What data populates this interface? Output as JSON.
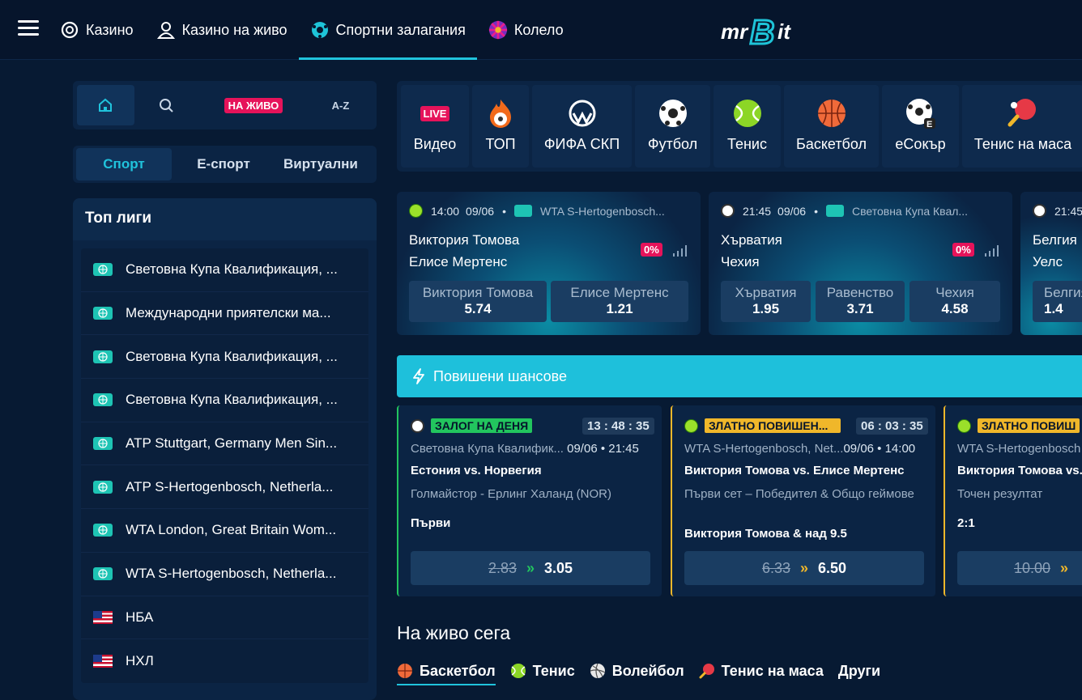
{
  "nav": {
    "items": [
      {
        "label": "Казино",
        "icon": "casino-chip-icon"
      },
      {
        "label": "Казино на живо",
        "icon": "live-dealer-icon"
      },
      {
        "label": "Спортни залагания",
        "icon": "soccer-ball-icon"
      },
      {
        "label": "Колело",
        "icon": "wheel-icon"
      }
    ],
    "logo_text": "mrBit"
  },
  "quick": {
    "live_label": "НА ЖИВО",
    "az_label": "A-Z"
  },
  "sport_tabs": [
    "Спорт",
    "Е-спорт",
    "Виртуални"
  ],
  "leagues": {
    "title": "Топ лиги",
    "items": [
      "Световна Купа Квалификация, ...",
      "Международни приятелски ма...",
      "Световна Купа Квалификация, ...",
      "Световна Купа Квалификация, ...",
      "ATP Stuttgart, Germany Men Sin...",
      "ATP S-Hertogenbosch, Netherla...",
      "WTA London, Great Britain Wom...",
      "WTA S-Hertogenbosch, Netherla...",
      "НБА",
      "НХЛ"
    ]
  },
  "sports": [
    {
      "label": "Видео",
      "live_badge": "LIVE"
    },
    {
      "label": "ТОП"
    },
    {
      "label": "ФИФА СКП"
    },
    {
      "label": "Футбол"
    },
    {
      "label": "Тенис"
    },
    {
      "label": "Баскетбол"
    },
    {
      "label": "еСокър",
      "badge": "E"
    },
    {
      "label": "Тенис на маса"
    }
  ],
  "matches": [
    {
      "time": "14:00",
      "date": "09/06",
      "league": "WTA S-Hertogenbosch...",
      "team1": "Виктория Томова",
      "team2": "Елисе Мертенс",
      "margin": "0%",
      "odds": [
        {
          "name": "Виктория Томова",
          "value": "5.74"
        },
        {
          "name": "Елисе Мертенс",
          "value": "1.21"
        }
      ]
    },
    {
      "time": "21:45",
      "date": "09/06",
      "league": "Световна Купа Квал...",
      "team1": "Хърватия",
      "team2": "Чехия",
      "margin": "0%",
      "odds": [
        {
          "name": "Хърватия",
          "value": "1.95"
        },
        {
          "name": "Равенство",
          "value": "3.71"
        },
        {
          "name": "Чехия",
          "value": "4.58"
        }
      ]
    },
    {
      "time": "21:45",
      "team1": "Белгия",
      "team2": "Уелс",
      "odds": [
        {
          "name": "Белгия",
          "value": "1.4"
        }
      ]
    }
  ],
  "boost": {
    "title": "Повишени шансове"
  },
  "boost_cards": [
    {
      "tag": "ЗАЛОГ НА ДЕНЯ",
      "tag_color": "#22c55e",
      "timer": "13 : 48 : 35",
      "league": "Световна Купа Квалифик...",
      "datetime": "09/06 • 21:45",
      "match": "Естония vs. Норвегия",
      "market": "Голмайстор - Ерлинг Халанд (NOR)",
      "selection": "Първи",
      "old": "2.83",
      "new": "3.05"
    },
    {
      "tag": "ЗЛАТНО ПОВИШЕН...",
      "tag_color": "#f0b72a",
      "timer": "06 : 03 : 35",
      "league": "WTA S-Hertogenbosch, Net...",
      "datetime": "09/06 • 14:00",
      "match": "Виктория Томова vs. Елисе Мертенс",
      "market": "Първи сет – Победител & Общо геймове",
      "selection": "Виктория Томова & над 9.5",
      "old": "6.33",
      "new": "6.50"
    },
    {
      "tag": "ЗЛАТНО ПОВИШ",
      "tag_color": "#f0b72a",
      "league": "WTA S-Hertogenbosch",
      "match": "Виктория Томова vs.",
      "market": "Точен резултат",
      "selection": "2:1",
      "old": "10.00"
    }
  ],
  "live_now": {
    "title": "На живо сега",
    "tabs": [
      "Баскетбол",
      "Тенис",
      "Волейбол",
      "Тенис на маса",
      "Други"
    ]
  }
}
